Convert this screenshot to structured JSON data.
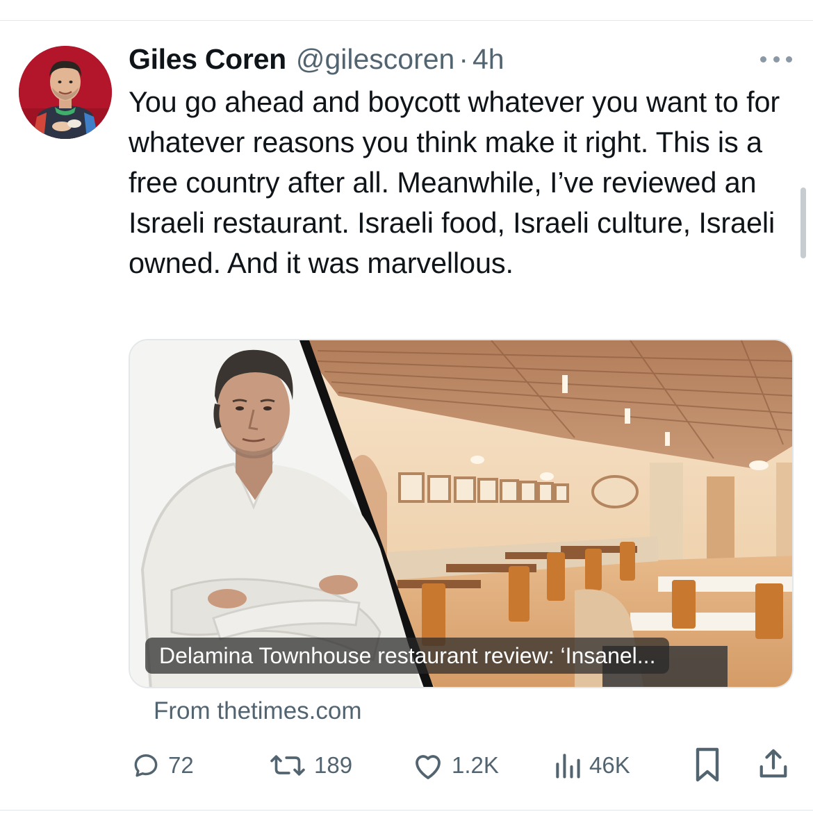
{
  "tweet": {
    "display_name": "Giles Coren",
    "handle": "@gilescoren",
    "separator": "·",
    "time": "4h",
    "text": "You go ahead and boycott whatever you want to for whatever reasons you think make it right. This is a free country after all. Meanwhile, I’ve reviewed an Israeli restaurant. Israeli food, Israeli culture, Israeli owned. And it was marvellous."
  },
  "card": {
    "caption": "Delamina Townhouse restaurant review: ‘Insanel...",
    "source": "From thetimes.com"
  },
  "actions": {
    "replies": "72",
    "reposts": "189",
    "likes": "1.2K",
    "views": "46K"
  },
  "icons": {
    "more": "more-dots-icon",
    "reply": "reply-icon",
    "repost": "repost-icon",
    "like": "heart-icon",
    "views": "views-chart-icon",
    "bookmark": "bookmark-icon",
    "share": "share-icon"
  },
  "colors": {
    "text": "#0f1419",
    "secondary": "#536471",
    "divider": "#e4e7ea"
  }
}
